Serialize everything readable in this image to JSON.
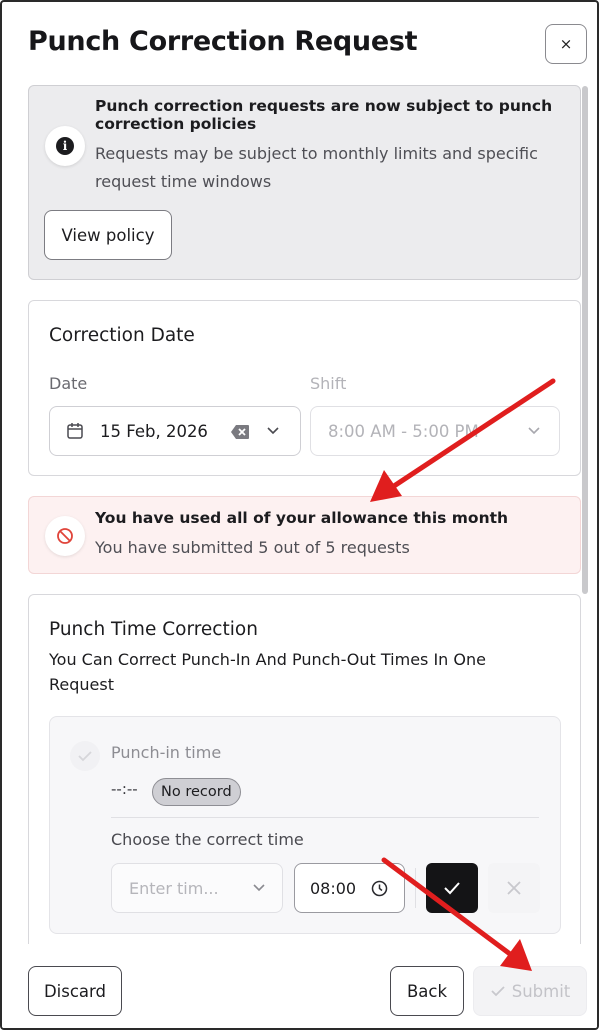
{
  "dialog": {
    "title": "Punch Correction Request",
    "close_label": "×"
  },
  "policy_notice": {
    "title": "Punch correction requests are now subject to punch correction policies",
    "body": "Requests may be subject to monthly limits and specific request time windows",
    "button_label": "View policy",
    "icon": "info-icon"
  },
  "correction_date": {
    "section_title": "Correction Date",
    "date_label": "Date",
    "date_value": "15 Feb, 2026",
    "shift_label": "Shift",
    "shift_value": "8:00 AM - 5:00 PM"
  },
  "allowance_alert": {
    "title": "You have used all of your allowance this month",
    "body": "You have submitted 5 out of 5 requests",
    "icon": "prohibited-icon",
    "color": "#e0443a"
  },
  "punch_time": {
    "section_title": "Punch Time Correction",
    "subtitle": "You Can Correct Punch-In And Punch-Out Times In One Request",
    "punch_in_label": "Punch-in time",
    "current_time": "--:--",
    "record_badge": "No record",
    "choose_label": "Choose the correct time",
    "enter_time_placeholder": "Enter tim...",
    "time_value": "08:00"
  },
  "footer": {
    "discard_label": "Discard",
    "back_label": "Back",
    "submit_label": "Submit"
  },
  "colors": {
    "annotation_arrow": "#e01e1e",
    "confirm_button": "#141416",
    "alert_background": "#fdf1f1"
  }
}
